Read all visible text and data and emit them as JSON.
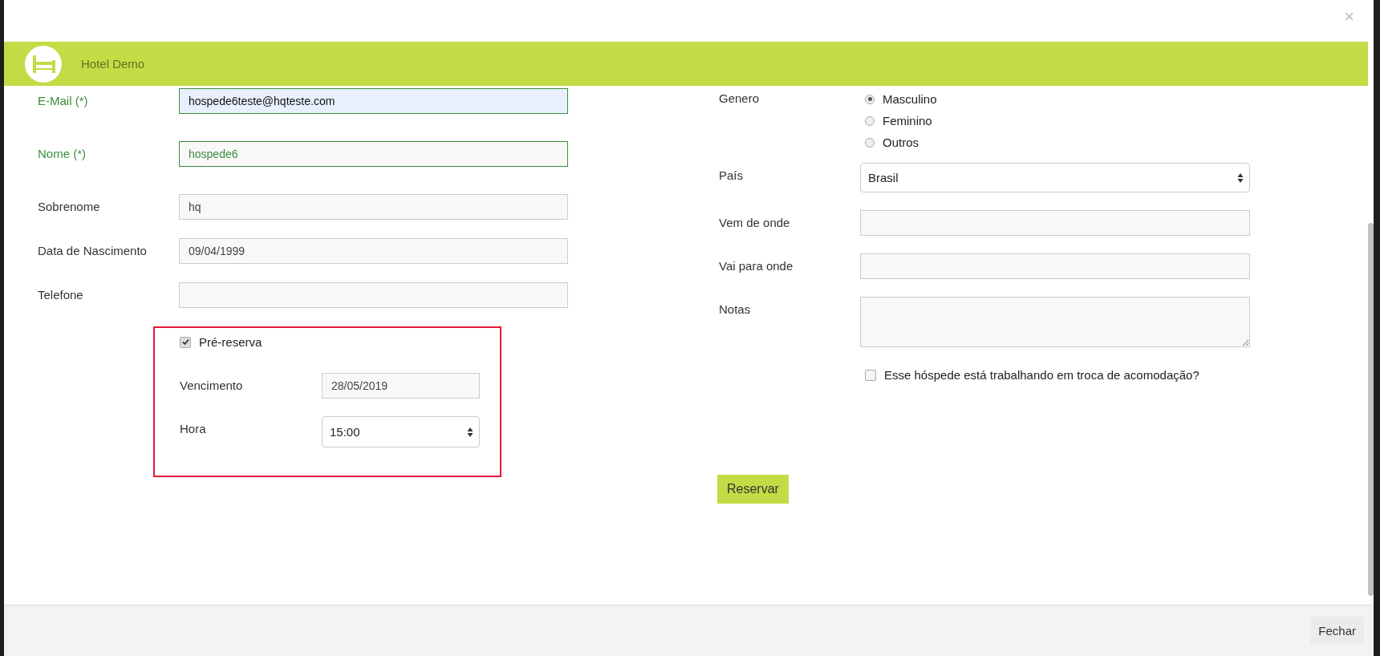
{
  "window": {
    "close": "×"
  },
  "header": {
    "title": "Hotel Demo"
  },
  "left_fields": [
    {
      "label": "E-Mail (*)",
      "value": "hospede6teste@hqteste.com",
      "valid": true,
      "autofilled": true
    },
    {
      "label": "Nome (*)",
      "value": "hospede6",
      "valid": true,
      "autofilled": false
    },
    {
      "label": "Sobrenome",
      "value": "hq",
      "valid": false,
      "autofilled": false
    },
    {
      "label": "Data de Nascimento",
      "value": "09/04/1999",
      "valid": false,
      "autofilled": false
    },
    {
      "label": "Telefone",
      "valid": false,
      "autofilled": false
    }
  ],
  "pre_reservation": {
    "label": "Pré-reserva",
    "checked": true,
    "fields": [
      {
        "kind": "input",
        "label": "Vencimento",
        "value": "28/05/2019"
      },
      {
        "kind": "select",
        "label": "Hora",
        "value": "15:00"
      }
    ]
  },
  "gender": {
    "label": "Genero",
    "options": [
      {
        "label": "Masculino",
        "selected": true
      },
      {
        "label": "Feminino",
        "selected": false
      },
      {
        "label": "Outros",
        "selected": false
      }
    ]
  },
  "right_fields": [
    {
      "kind": "select",
      "label": "País",
      "value": "Brasil"
    },
    {
      "kind": "input",
      "label": "Vem de onde"
    },
    {
      "kind": "input",
      "label": "Vai para onde"
    },
    {
      "kind": "textarea",
      "label": "Notas"
    }
  ],
  "work_exchange": {
    "label": "Esse hóspede está trabalhando em troca de acomodação?",
    "checked": false
  },
  "submit_button": "Reservar",
  "footer": {
    "close_button": "Fechar"
  }
}
